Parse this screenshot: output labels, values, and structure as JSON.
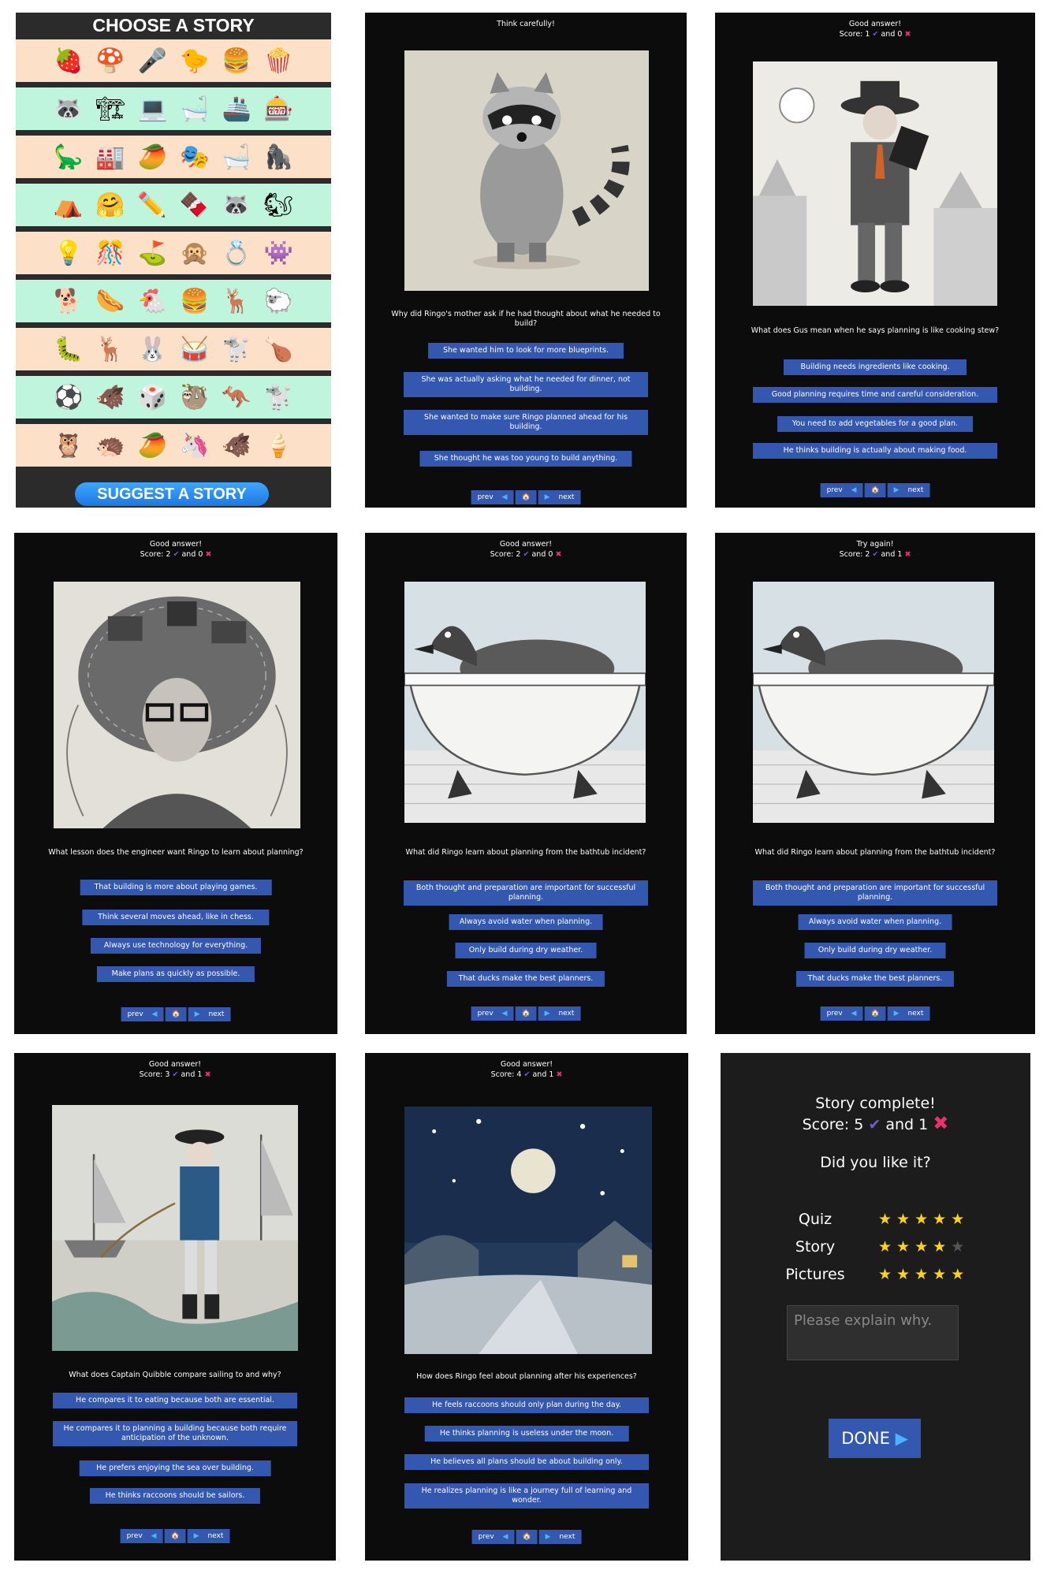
{
  "menu": {
    "title": "CHOOSE A STORY",
    "suggest_label": "SUGGEST A STORY",
    "rows": [
      {
        "bg": "#fde0c8",
        "icons": [
          "🍓",
          "🍄",
          "🎤",
          "🐤",
          "🍔",
          "🍿"
        ]
      },
      {
        "bg": "#bff5dc",
        "icons": [
          "🦝",
          "🏗",
          "💻",
          "🛁",
          "🚢",
          "🎰"
        ]
      },
      {
        "bg": "#fde0c8",
        "icons": [
          "🦕",
          "🏭",
          "🥭",
          "🎭",
          "🛁",
          "🦍"
        ]
      },
      {
        "bg": "#bff5dc",
        "icons": [
          "⛺",
          "🤗",
          "✏️",
          "🍫",
          "🦝",
          "🐿"
        ]
      },
      {
        "bg": "#fde0c8",
        "icons": [
          "💡",
          "🎊",
          "⛳",
          "🙊",
          "💍",
          "👾"
        ]
      },
      {
        "bg": "#bff5dc",
        "icons": [
          "🐕",
          "🌭",
          "🐔",
          "🍔",
          "🦌",
          "🐑"
        ]
      },
      {
        "bg": "#fde0c8",
        "icons": [
          "🐛",
          "🦌",
          "🐰",
          "🥁",
          "🐩",
          "🍗"
        ]
      },
      {
        "bg": "#bff5dc",
        "icons": [
          "⚽",
          "🐗",
          "🎲",
          "🦥",
          "🦘",
          "🐩"
        ]
      },
      {
        "bg": "#fde0c8",
        "icons": [
          "🦉",
          "🦔",
          "🥭",
          "🦄",
          "🐗",
          "🍦"
        ]
      }
    ]
  },
  "nav": {
    "prev": "prev",
    "next": "next",
    "home": "🏠",
    "tri_left": "◀",
    "tri_right": "▶"
  },
  "score_and": "and",
  "panels": [
    {
      "header": "Think carefully!",
      "score": null,
      "question": "Why did Ringo's mother ask if he had thought about what he needed to build?",
      "answers": [
        "She wanted him to look for more blueprints.",
        "She was actually asking what he needed for dinner, not building.",
        "She wanted to make sure Ringo planned ahead for his building.",
        "She thought he was too young to build anything."
      ]
    },
    {
      "header": "Good answer!",
      "score": {
        "label": "Score:",
        "right": "1",
        "wrong": "0"
      },
      "question": "What does Gus mean when he says planning is like cooking stew?",
      "answers": [
        "Building needs ingredients like cooking.",
        "Good planning requires time and careful consideration.",
        "You need to add vegetables for a good plan.",
        "He thinks building is actually about making food."
      ]
    },
    {
      "header": "Good answer!",
      "score": {
        "label": "Score:",
        "right": "2",
        "wrong": "0"
      },
      "question": "What lesson does the engineer want Ringo to learn about planning?",
      "answers": [
        "That building is more about playing games.",
        "Think several moves ahead, like in chess.",
        "Always use technology for everything.",
        "Make plans as quickly as possible."
      ]
    },
    {
      "header": "Good answer!",
      "score": {
        "label": "Score:",
        "right": "2",
        "wrong": "0"
      },
      "question": "What did Ringo learn about planning from the bathtub incident?",
      "answers": [
        "Both thought and preparation are important for successful planning.",
        "Always avoid water when planning.",
        "Only build during dry weather.",
        "That ducks make the best planners."
      ]
    },
    {
      "header": "Try again!",
      "score": {
        "label": "Score:",
        "right": "2",
        "wrong": "1"
      },
      "question": "What did Ringo learn about planning from the bathtub incident?",
      "answers": [
        "Both thought and preparation are important for successful planning.",
        "Always avoid water when planning.",
        "Only build during dry weather.",
        "That ducks make the best planners."
      ]
    },
    {
      "header": "Good answer!",
      "score": {
        "label": "Score:",
        "right": "3",
        "wrong": "1"
      },
      "question": "What does Captain Quibble compare sailing to and why?",
      "answers": [
        "He compares it to eating because both are essential.",
        "He compares it to planning a building because both require anticipation of the unknown.",
        "He prefers enjoying the sea over building.",
        "He thinks raccoons should be sailors."
      ]
    },
    {
      "header": "Good answer!",
      "score": {
        "label": "Score:",
        "right": "4",
        "wrong": "1"
      },
      "question": "How does Ringo feel about planning after his experiences?",
      "answers": [
        "He feels raccoons should only plan during the day.",
        "He thinks planning is useless under the moon.",
        "He believes all plans should be about building only.",
        "He realizes planning is like a journey full of learning and wonder."
      ]
    }
  ],
  "final": {
    "complete": "Story complete!",
    "score_label": "Score:",
    "right": "5",
    "wrong": "1",
    "like": "Did you like it?",
    "ratings": [
      {
        "label": "Quiz",
        "stars": 5
      },
      {
        "label": "Story",
        "stars": 4
      },
      {
        "label": "Pictures",
        "stars": 5
      }
    ],
    "why_placeholder": "Please explain why.",
    "done_label": "DONE",
    "done_icon": "▶"
  },
  "colors": {
    "accent": "#3457b0",
    "check": "#6f5bd1",
    "cross": "#e8336a",
    "star": "#ffd21a"
  }
}
